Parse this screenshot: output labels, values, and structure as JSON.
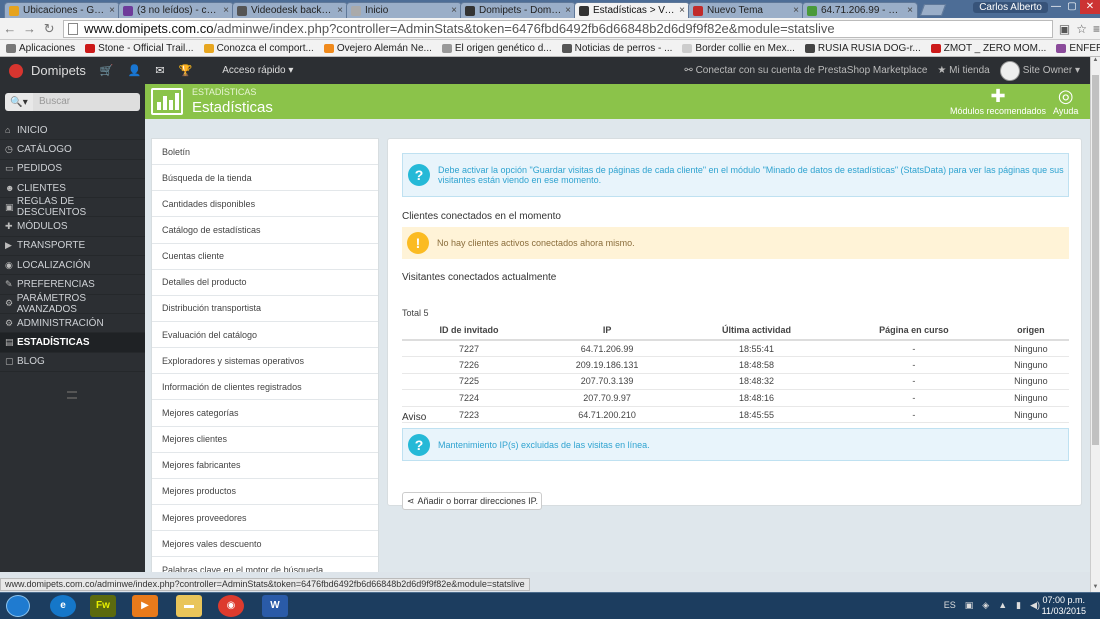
{
  "browser": {
    "tabs": [
      {
        "title": "Ubicaciones - Googl",
        "color": "#e6a31e",
        "active": false
      },
      {
        "title": "(3 no leídos) - cagud",
        "color": "#6e3b9a",
        "active": false
      },
      {
        "title": "Videodesk back-offic",
        "color": "#555555",
        "active": false
      },
      {
        "title": "Inicio",
        "color": "#aaaaaa",
        "active": false
      },
      {
        "title": "Domipets - Domipet",
        "color": "#333333",
        "active": false
      },
      {
        "title": "Estadísticas > Ver / D",
        "color": "#333333",
        "active": true
      },
      {
        "title": "Nuevo Tema",
        "color": "#c12a2a",
        "active": false
      },
      {
        "title": "64.71.206.99 - Ver Dir",
        "color": "#4a9a3a",
        "active": false
      }
    ],
    "window_user": "Carlos Alberto",
    "url_domain": "www.domipets.com.co",
    "url_path": "/adminwe/index.php?controller=AdminStats&token=6476fbd6492fb6d66848b2d6d9f9f82e&module=statslive",
    "bookmarks": [
      {
        "label": "Aplicaciones",
        "color": "#777777"
      },
      {
        "label": "Stone - Official Trail...",
        "color": "#cc1a1a"
      },
      {
        "label": "Conozca el comport...",
        "color": "#e7a620"
      },
      {
        "label": "Ovejero Alemán Ne...",
        "color": "#f08a1c"
      },
      {
        "label": "El origen genético d...",
        "color": "#999999"
      },
      {
        "label": "Noticias de perros - ...",
        "color": "#555555"
      },
      {
        "label": "Border collie en Mex...",
        "color": "#cccccc"
      },
      {
        "label": "RUSIA RUSIA DOG-r...",
        "color": "#444444"
      },
      {
        "label": "ZMOT _ ZERO MOM...",
        "color": "#cc1a1a"
      },
      {
        "label": "ENFERMEDADES INF...",
        "color": "#8a4a9a"
      }
    ],
    "status_bar": "www.domipets.com.co/adminwe/index.php?controller=AdminStats&token=6476fbd6492fb6d66848b2d6d9f9f82e&module=statslive"
  },
  "header": {
    "brand": "Domipets",
    "quick_access": "Acceso rápido",
    "marketplace": "Conectar con su cuenta de PrestaShop Marketplace",
    "my_shop": "Mi tienda",
    "user": "Site Owner"
  },
  "sidebar": {
    "search_placeholder": "Buscar",
    "items": [
      {
        "label": "Inicio",
        "icon": "⌂"
      },
      {
        "label": "Catálogo",
        "icon": "◷"
      },
      {
        "label": "Pedidos",
        "icon": "▭"
      },
      {
        "label": "Clientes",
        "icon": "☻"
      },
      {
        "label": "Reglas de descuentos",
        "icon": "▣"
      },
      {
        "label": "Módulos",
        "icon": "✚"
      },
      {
        "label": "Transporte",
        "icon": "▶"
      },
      {
        "label": "Localización",
        "icon": "◉"
      },
      {
        "label": "Preferencias",
        "icon": "✎"
      },
      {
        "label": "Parámetros avanzados",
        "icon": "⚙"
      },
      {
        "label": "Administración",
        "icon": "⚙"
      },
      {
        "label": "Estadísticas",
        "icon": "▤"
      },
      {
        "label": "Blog",
        "icon": "▢"
      }
    ],
    "active_index": 11
  },
  "page": {
    "breadcrumb": "ESTADÍSTICAS",
    "title": "Estadísticas",
    "btn_modules": "Módulos recomendados",
    "btn_help": "Ayuda"
  },
  "modules": [
    "Boletín",
    "Búsqueda de la tienda",
    "Cantidades disponibles",
    "Catálogo de estadísticas",
    "Cuentas cliente",
    "Detalles del producto",
    "Distribución transportista",
    "Evaluación del catálogo",
    "Exploradores y sistemas operativos",
    "Información de clientes registrados",
    "Mejores categorías",
    "Mejores clientes",
    "Mejores fabricantes",
    "Mejores productos",
    "Mejores proveedores",
    "Mejores vales descuento",
    "Palabras clave en el motor de búsqueda"
  ],
  "panel": {
    "info_text": "Debe activar la opción \"Guardar visitas de páginas de cada cliente\" en el módulo \"Minado de datos de estadísticas\" (StatsData) para ver las páginas que sus visitantes están viendo en ese momento.",
    "clients_title": "Clientes conectados en el momento",
    "no_clients": "No hay clientes activos conectados ahora mismo.",
    "visitors_title": "Visitantes conectados actualmente",
    "total": "Total 5",
    "columns": [
      "ID de invitado",
      "IP",
      "Última actividad",
      "Página en curso",
      "origen"
    ],
    "rows": [
      [
        "7227",
        "64.71.206.99",
        "18:55:41",
        "-",
        "Ninguno"
      ],
      [
        "7226",
        "209.19.186.131",
        "18:48:58",
        "-",
        "Ninguno"
      ],
      [
        "7225",
        "207.70.3.139",
        "18:48:32",
        "-",
        "Ninguno"
      ],
      [
        "7224",
        "207.70.9.97",
        "18:48:16",
        "-",
        "Ninguno"
      ],
      [
        "7223",
        "64.71.200.210",
        "18:45:55",
        "-",
        "Ninguno"
      ]
    ],
    "notice_title": "Aviso",
    "notice_text": "Mantenimiento IP(s) excluidas de las visitas en línea.",
    "ip_button": "Añadir o borrar direcciones IP."
  },
  "taskbar": {
    "language": "ES",
    "time": "07:00 p.m.",
    "date": "11/03/2015"
  }
}
